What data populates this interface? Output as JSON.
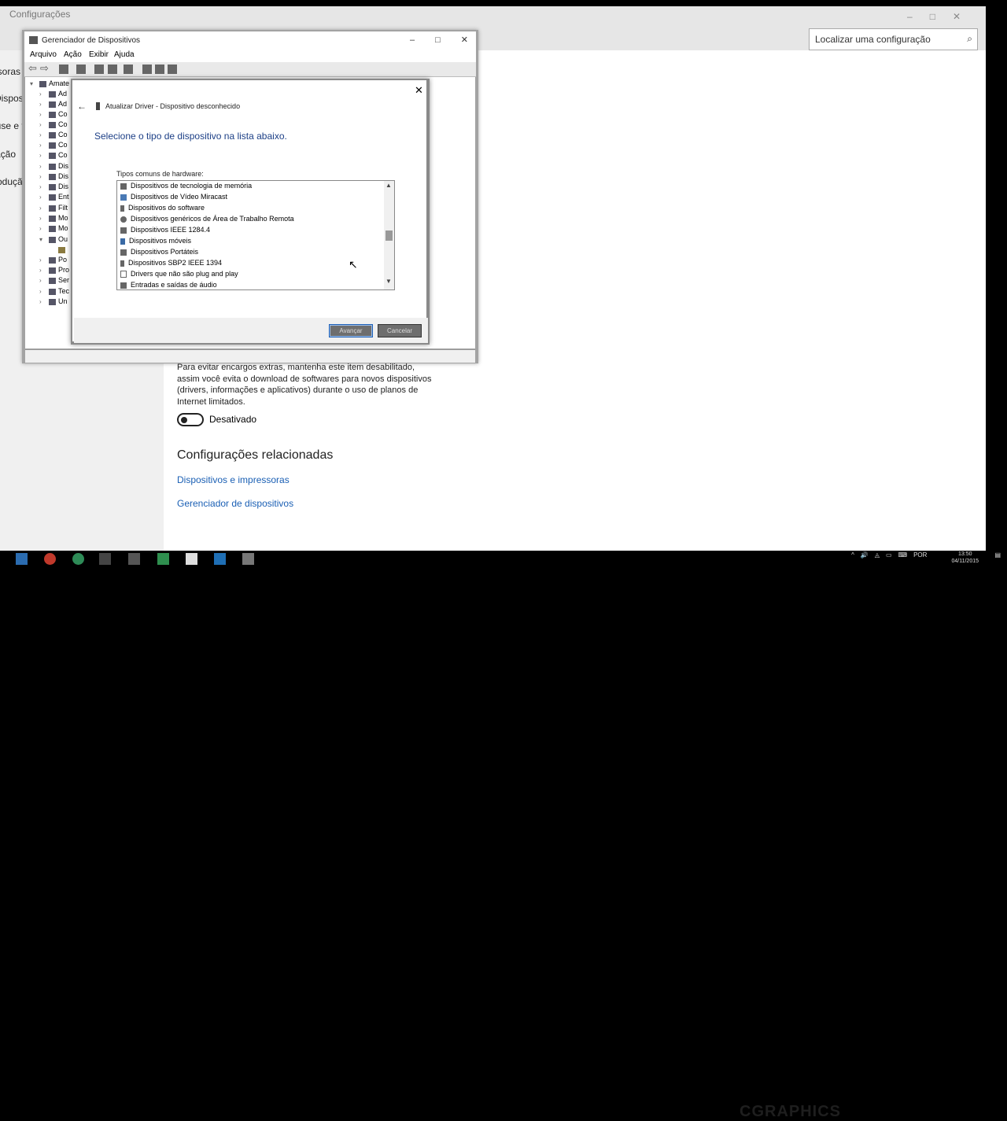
{
  "settings": {
    "title": "Configurações",
    "search_placeholder": "Localizar uma configuração",
    "left_items": [
      "Impressoras",
      "Dispositivos",
      "Mouse e touchpad",
      "Digitação",
      "Reprodução"
    ],
    "setting_description": "Para evitar encargos extras, mantenha este item desabilitado, assim você evita o download de softwares para novos dispositivos (drivers, informações e aplicativos) durante o uso de planos de Internet limitados.",
    "toggle_state_label": "Desativado",
    "related_title": "Configurações relacionadas",
    "links": [
      "Dispositivos e impressoras",
      "Gerenciador de dispositivos"
    ]
  },
  "device_manager": {
    "title": "Gerenciador de Dispositivos",
    "menu": [
      "Arquivo",
      "Ação",
      "Exibir",
      "Ajuda"
    ],
    "tree_root": "Amate",
    "tree_items": [
      "Ad",
      "Ad",
      "Co",
      "Co",
      "Co",
      "Co",
      "Co",
      "Dis",
      "Dis",
      "Dis",
      "Ent",
      "Filt",
      "Mo",
      "Mo",
      "Ou",
      "",
      "Po",
      "Pro",
      "Ser",
      "Tec",
      "Un"
    ]
  },
  "update_driver": {
    "header": "Atualizar Driver - Dispositivo desconhecido",
    "instruction": "Selecione o tipo de dispositivo na lista abaixo.",
    "list_label": "Tipos comuns de hardware:",
    "list_items": [
      "Dispositivos de tecnologia de memória",
      "Dispositivos de Vídeo Miracast",
      "Dispositivos do software",
      "Dispositivos genéricos de Área de Trabalho Remota",
      "Dispositivos IEEE 1284.4",
      "Dispositivos móveis",
      "Dispositivos Portáteis",
      "Dispositivos SBP2 IEEE 1394",
      "Drivers que não são plug and play",
      "Entradas e saídas de áudio"
    ],
    "next_label": "Avançar",
    "cancel_label": "Cancelar"
  },
  "taskbar": {
    "language": "POR",
    "time": "13:50",
    "date": "04/11/2015",
    "watermark": "CGRAPHICS"
  }
}
